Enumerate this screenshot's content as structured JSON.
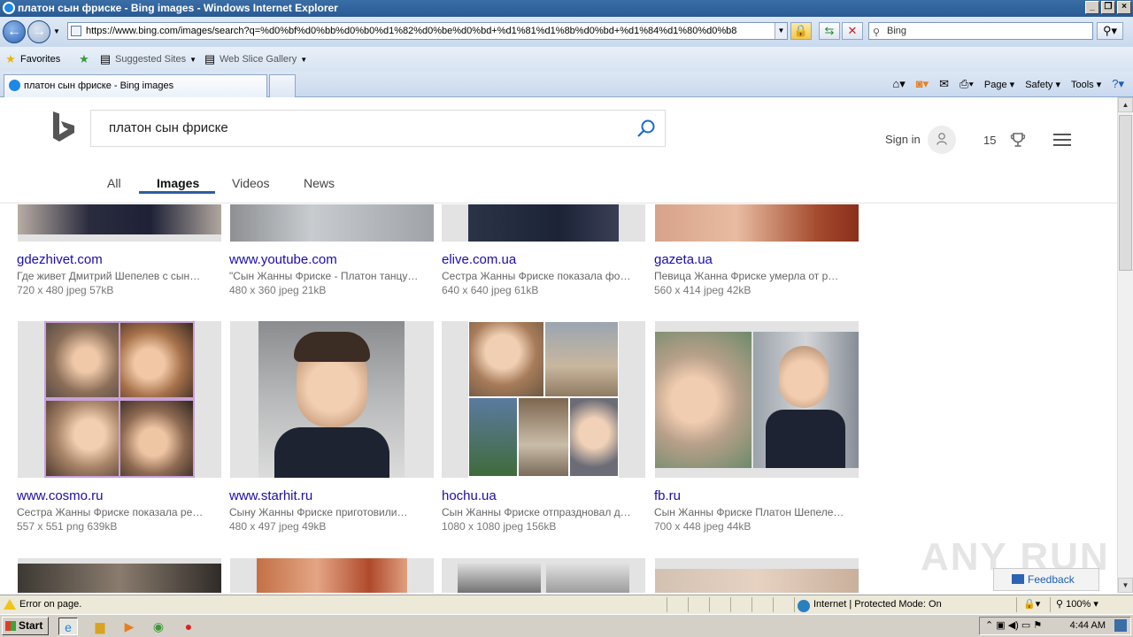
{
  "window": {
    "title": "платон сын фриске - Bing images - Windows Internet Explorer"
  },
  "address_bar": {
    "url": "https://www.bing.com/images/search?q=%d0%bf%d0%bb%d0%b0%d1%82%d0%be%d0%bd+%d1%81%d1%8b%d0%bd+%d1%84%d1%80%d0%b8",
    "search_placeholder": "Bing"
  },
  "favorites_bar": {
    "favorites_label": "Favorites",
    "suggested_sites": "Suggested Sites",
    "web_slice_gallery": "Web Slice Gallery"
  },
  "tabs": [
    {
      "label": "платон сын фриске - Bing images"
    }
  ],
  "command_bar": {
    "page": "Page",
    "safety": "Safety",
    "tools": "Tools"
  },
  "bing": {
    "query": "платон сын фриске",
    "sign_in": "Sign in",
    "rewards_count": "15",
    "scopes": [
      "All",
      "Images",
      "Videos",
      "News"
    ],
    "active_scope": "Images"
  },
  "results": {
    "row1": [
      {
        "host": "gdezhivet.com",
        "desc": "Где живет Дмитрий Шепелев с сын…",
        "meta": "720 x 480 jpeg 57kB"
      },
      {
        "host": "www.youtube.com",
        "desc": "\"Сын Жанны Фриске - Платон танцу…",
        "meta": "480 x 360 jpeg 21kB"
      },
      {
        "host": "elive.com.ua",
        "desc": "Сестра Жанны Фриске показала фо…",
        "meta": "640 x 640 jpeg 61kB"
      },
      {
        "host": "gazeta.ua",
        "desc": "Певица Жанна Фриске умерла от р…",
        "meta": "560 x 414 jpeg 42kB"
      }
    ],
    "row2": [
      {
        "host": "www.cosmo.ru",
        "desc": "Сестра Жанны Фриске показала ре…",
        "meta": "557 x 551 png 639kB"
      },
      {
        "host": "www.starhit.ru",
        "desc": "Сыну Жанны Фриске приготовили…",
        "meta": "480 x 497 jpeg 49kB"
      },
      {
        "host": "hochu.ua",
        "desc": "Сын Жанны Фриске отпраздновал д…",
        "meta": "1080 x 1080 jpeg 156kB"
      },
      {
        "host": "fb.ru",
        "desc": "Сын Жанны Фриске Платон Шепеле…",
        "meta": "700 x 448 jpeg 44kB"
      }
    ]
  },
  "feedback_label": "Feedback",
  "watermark": "ANY RUN",
  "status_bar": {
    "message": "Error on page.",
    "zone": "Internet | Protected Mode: On",
    "zoom": "100%"
  },
  "taskbar": {
    "start": "Start",
    "clock": "4:44 AM"
  },
  "colors": {
    "link": "#1a0dab",
    "accent": "#2b5fa0",
    "titlebar": "#2a5a94"
  }
}
